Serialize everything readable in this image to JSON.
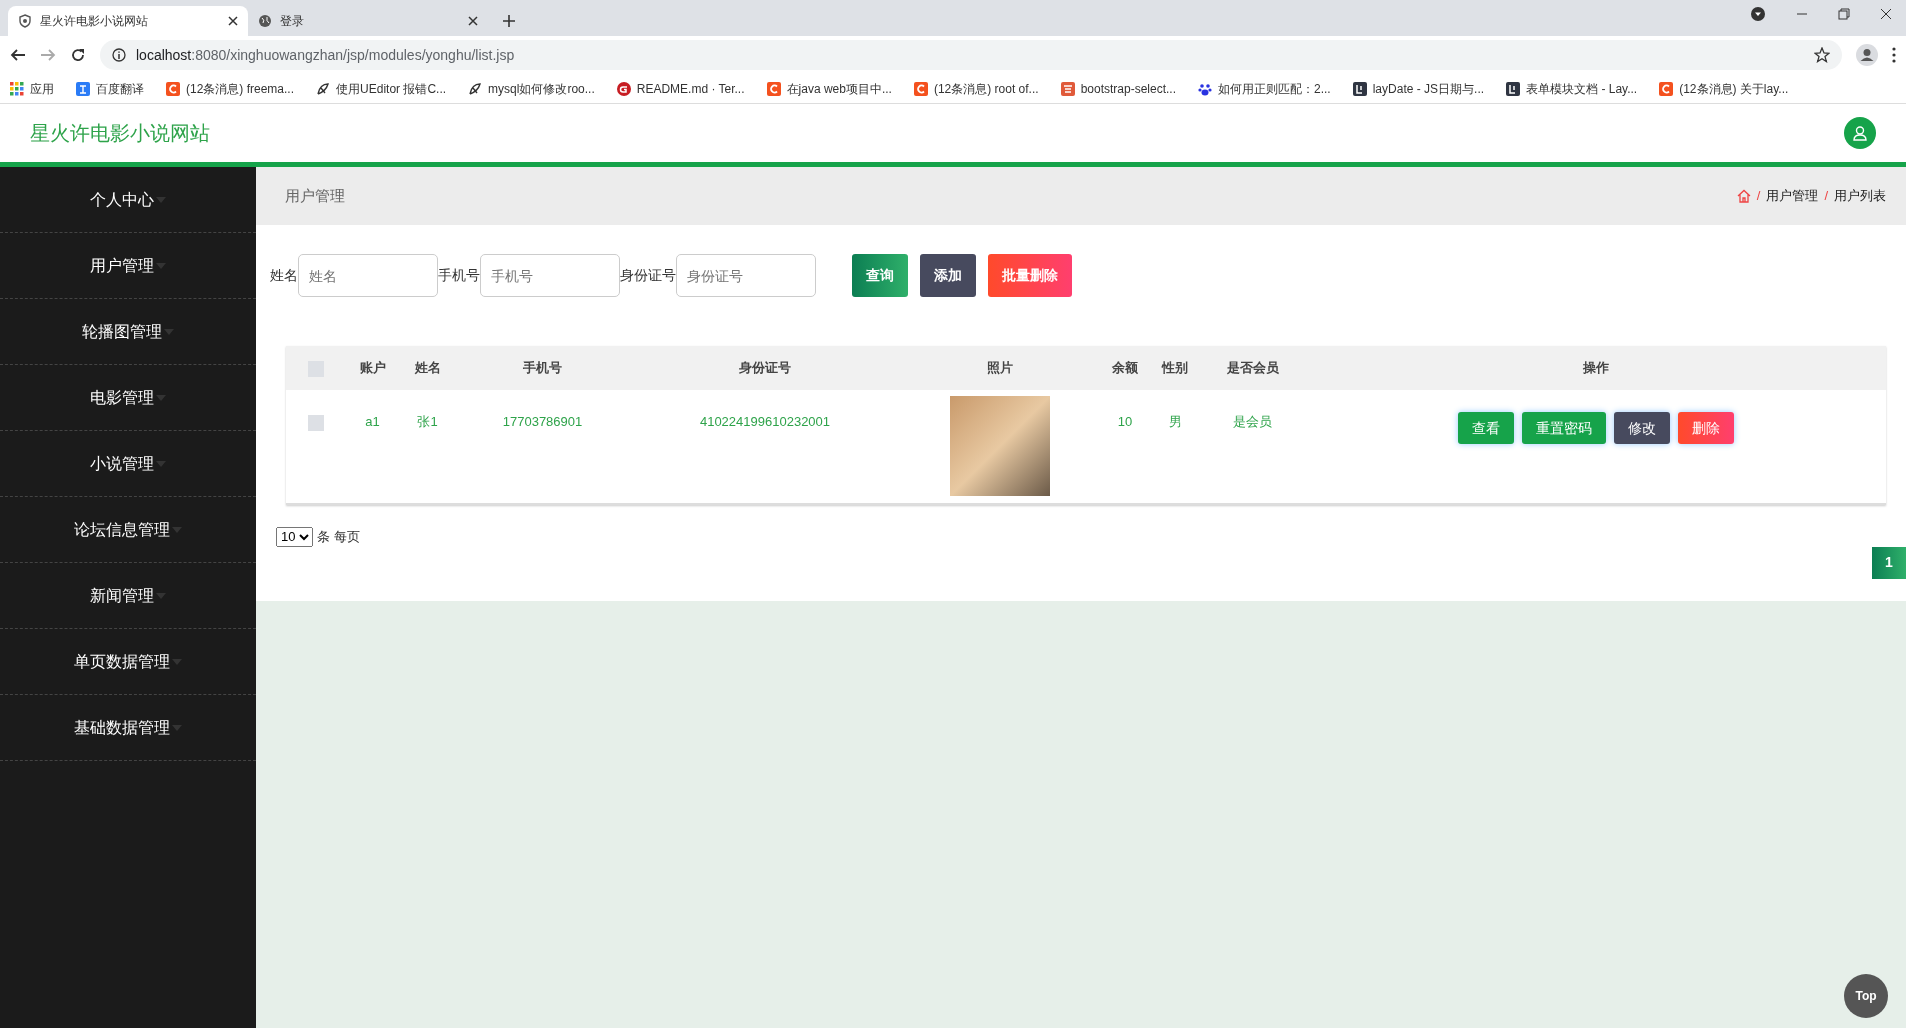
{
  "browser": {
    "tabs": [
      {
        "title": "星火许电影小说网站",
        "selected": true,
        "kind": "shield"
      },
      {
        "title": "登录",
        "selected": false,
        "kind": "globe"
      }
    ],
    "url": {
      "host": "localhost",
      "path": ":8080/xinghuowangzhan/jsp/modules/yonghu/list.jsp"
    },
    "bookmarks": [
      {
        "label": "应用",
        "kind": "apps"
      },
      {
        "label": "百度翻译",
        "kind": "translate"
      },
      {
        "label": "(12条消息) freema...",
        "kind": "csdn"
      },
      {
        "label": "使用UEditor 报错C...",
        "kind": "ueditor"
      },
      {
        "label": "mysql如何修改roo...",
        "kind": "ueditor"
      },
      {
        "label": "README.md · Ter...",
        "kind": "gitee"
      },
      {
        "label": "在java web项目中...",
        "kind": "csdn"
      },
      {
        "label": "(12条消息) root of...",
        "kind": "csdn"
      },
      {
        "label": "bootstrap-select...",
        "kind": "jian"
      },
      {
        "label": "如何用正则匹配：2...",
        "kind": "baidu"
      },
      {
        "label": "layDate - JS日期与...",
        "kind": "layui"
      },
      {
        "label": "表单模块文档 - Lay...",
        "kind": "layui"
      },
      {
        "label": "(12条消息) 关于lay...",
        "kind": "csdn"
      }
    ]
  },
  "site": {
    "title": "星火许电影小说网站"
  },
  "sidebar": {
    "items": [
      {
        "label": "个人中心"
      },
      {
        "label": "用户管理"
      },
      {
        "label": "轮播图管理"
      },
      {
        "label": "电影管理"
      },
      {
        "label": "小说管理"
      },
      {
        "label": "论坛信息管理"
      },
      {
        "label": "新闻管理"
      },
      {
        "label": "单页数据管理"
      },
      {
        "label": "基础数据管理"
      }
    ]
  },
  "page_header": {
    "title": "用户管理",
    "breadcrumb": [
      {
        "separator": "/",
        "label": "用户管理"
      },
      {
        "separator": "/",
        "label": "用户列表"
      }
    ]
  },
  "filters": [
    {
      "label": "姓名",
      "placeholder": "姓名"
    },
    {
      "label": "手机号",
      "placeholder": "手机号"
    },
    {
      "label": "身份证号",
      "placeholder": "身份证号"
    }
  ],
  "actions": [
    {
      "label": "查询",
      "kind": "search"
    },
    {
      "label": "添加",
      "kind": "add"
    },
    {
      "label": "批量删除",
      "kind": "delete"
    }
  ],
  "table": {
    "header_checked": false,
    "columns": [
      "账户",
      "姓名",
      "手机号",
      "身份证号",
      "照片",
      "余额",
      "性别",
      "是否会员",
      "操作"
    ],
    "rows": [
      {
        "checked": false,
        "account": "a1",
        "name": "张1",
        "phone": "17703786901",
        "id_number": "410224199610232001",
        "balance": "10",
        "gender": "男",
        "member": "是会员",
        "buttons": [
          {
            "label": "查看",
            "kind": "view"
          },
          {
            "label": "重置密码",
            "kind": "reset"
          },
          {
            "label": "修改",
            "kind": "edit"
          },
          {
            "label": "删除",
            "kind": "delete"
          }
        ]
      }
    ]
  },
  "pagination": {
    "page_size": "10",
    "page_size_suffix": "条 每页",
    "pages": [
      {
        "label": "1",
        "selected": true
      }
    ]
  },
  "back_to_top": "Top"
}
